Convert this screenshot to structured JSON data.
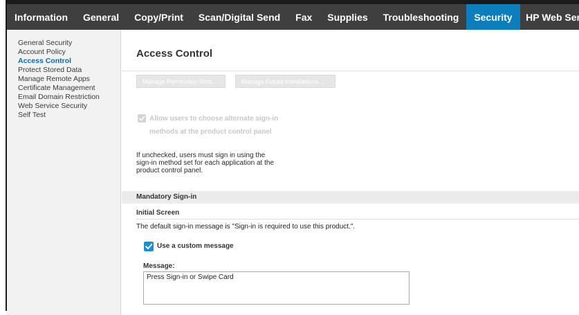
{
  "top_nav": {
    "tabs": [
      {
        "label": "Information"
      },
      {
        "label": "General"
      },
      {
        "label": "Copy/Print"
      },
      {
        "label": "Scan/Digital Send"
      },
      {
        "label": "Fax"
      },
      {
        "label": "Supplies"
      },
      {
        "label": "Troubleshooting"
      },
      {
        "label": "Security"
      },
      {
        "label": "HP Web Services"
      }
    ],
    "active": "Security"
  },
  "sidebar": {
    "items": [
      {
        "label": "General Security"
      },
      {
        "label": "Account Policy"
      },
      {
        "label": "Access Control"
      },
      {
        "label": "Protect Stored Data"
      },
      {
        "label": "Manage Remote Apps"
      },
      {
        "label": "Certificate Management"
      },
      {
        "label": "Email Domain Restriction"
      },
      {
        "label": "Web Service Security"
      },
      {
        "label": "Self Test"
      }
    ],
    "active": "Access Control"
  },
  "main": {
    "title": "Access Control",
    "buttons": {
      "manage_permission_sets": "Manage Permission Sets...",
      "manage_future_installations": "Manage Future Installations..."
    },
    "alternate_signin": {
      "label": "Allow users to choose alternate sign-in methods at the product control panel",
      "checked": true,
      "disabled": true,
      "help": "If unchecked, users must sign in using the sign-in method set for each application at the product control panel."
    },
    "mandatory_signin": {
      "section_title": "Mandatory Sign-in",
      "initial_screen_label": "Initial Screen",
      "default_message_text": "The default sign-in message is \"Sign-in is required to use this product.\".",
      "custom_message": {
        "label": "Use a custom message",
        "checked": true
      },
      "message_label": "Message:",
      "message_value": "Press Sign-in or Swipe Card"
    }
  },
  "colors": {
    "nav_bg": "#3f3f3f",
    "nav_active": "#0d7ebd",
    "sidebar_active": "#0d6aa6",
    "checkbox_checked": "#1a8fd6"
  }
}
